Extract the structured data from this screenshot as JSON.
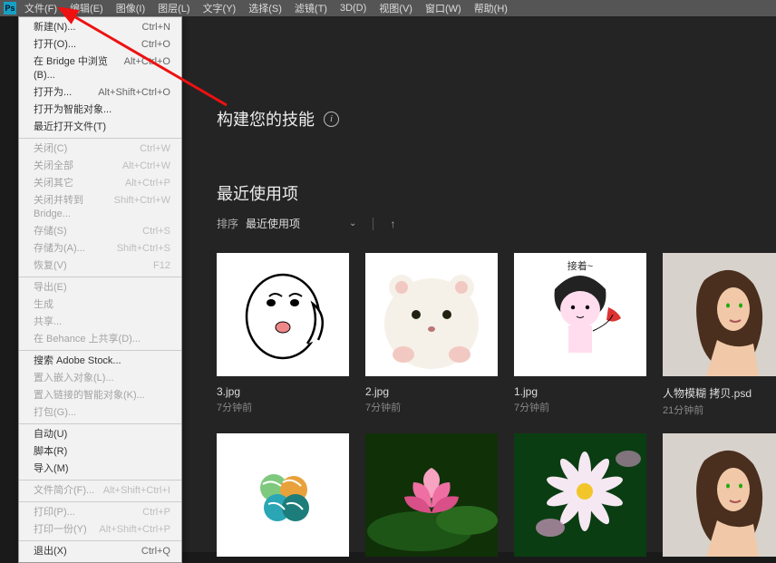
{
  "menubar": {
    "items": [
      "文件(F)",
      "编辑(E)",
      "图像(I)",
      "图层(L)",
      "文字(Y)",
      "选择(S)",
      "滤镜(T)",
      "3D(D)",
      "视图(V)",
      "窗口(W)",
      "帮助(H)"
    ]
  },
  "file_menu": {
    "groups": [
      [
        {
          "label": "新建(N)...",
          "shortcut": "Ctrl+N",
          "disabled": false
        },
        {
          "label": "打开(O)...",
          "shortcut": "Ctrl+O",
          "disabled": false
        },
        {
          "label": "在 Bridge 中浏览(B)...",
          "shortcut": "Alt+Ctrl+O",
          "disabled": false
        },
        {
          "label": "打开为...",
          "shortcut": "Alt+Shift+Ctrl+O",
          "disabled": false
        },
        {
          "label": "打开为智能对象...",
          "shortcut": "",
          "disabled": false
        },
        {
          "label": "最近打开文件(T)",
          "shortcut": "",
          "disabled": false
        }
      ],
      [
        {
          "label": "关闭(C)",
          "shortcut": "Ctrl+W",
          "disabled": true
        },
        {
          "label": "关闭全部",
          "shortcut": "Alt+Ctrl+W",
          "disabled": true
        },
        {
          "label": "关闭其它",
          "shortcut": "Alt+Ctrl+P",
          "disabled": true
        },
        {
          "label": "关闭并转到 Bridge...",
          "shortcut": "Shift+Ctrl+W",
          "disabled": true
        },
        {
          "label": "存储(S)",
          "shortcut": "Ctrl+S",
          "disabled": true
        },
        {
          "label": "存储为(A)...",
          "shortcut": "Shift+Ctrl+S",
          "disabled": true
        },
        {
          "label": "恢复(V)",
          "shortcut": "F12",
          "disabled": true
        }
      ],
      [
        {
          "label": "导出(E)",
          "shortcut": "",
          "disabled": true
        },
        {
          "label": "生成",
          "shortcut": "",
          "disabled": true
        },
        {
          "label": "共享...",
          "shortcut": "",
          "disabled": true
        },
        {
          "label": "在 Behance 上共享(D)...",
          "shortcut": "",
          "disabled": true
        }
      ],
      [
        {
          "label": "搜索 Adobe Stock...",
          "shortcut": "",
          "disabled": false
        },
        {
          "label": "置入嵌入对象(L)...",
          "shortcut": "",
          "disabled": true
        },
        {
          "label": "置入链接的智能对象(K)...",
          "shortcut": "",
          "disabled": true
        },
        {
          "label": "打包(G)...",
          "shortcut": "",
          "disabled": true
        }
      ],
      [
        {
          "label": "自动(U)",
          "shortcut": "",
          "disabled": false
        },
        {
          "label": "脚本(R)",
          "shortcut": "",
          "disabled": false
        },
        {
          "label": "导入(M)",
          "shortcut": "",
          "disabled": false
        }
      ],
      [
        {
          "label": "文件简介(F)...",
          "shortcut": "Alt+Shift+Ctrl+I",
          "disabled": true
        }
      ],
      [
        {
          "label": "打印(P)...",
          "shortcut": "Ctrl+P",
          "disabled": true
        },
        {
          "label": "打印一份(Y)",
          "shortcut": "Alt+Shift+Ctrl+P",
          "disabled": true
        }
      ],
      [
        {
          "label": "退出(X)",
          "shortcut": "Ctrl+Q",
          "disabled": false
        }
      ]
    ]
  },
  "content": {
    "skill_title": "构建您的技能",
    "recent_title": "最近使用项",
    "sort_label": "排序",
    "sort_value": "最近使用项"
  },
  "recent_items": [
    {
      "name": "3.jpg",
      "time": "7分钟前",
      "thumb": "face-meme"
    },
    {
      "name": "2.jpg",
      "time": "7分钟前",
      "thumb": "hamster"
    },
    {
      "name": "1.jpg",
      "time": "7分钟前",
      "thumb": "girl-doodle"
    },
    {
      "name": "人物模糊 拷贝.psd",
      "time": "21分钟前",
      "thumb": "portrait"
    },
    {
      "name": "",
      "time": "",
      "thumb": "logo-leaves"
    },
    {
      "name": "",
      "time": "",
      "thumb": "lotus"
    },
    {
      "name": "",
      "time": "",
      "thumb": "daisy"
    },
    {
      "name": "",
      "time": "",
      "thumb": "portrait"
    }
  ]
}
